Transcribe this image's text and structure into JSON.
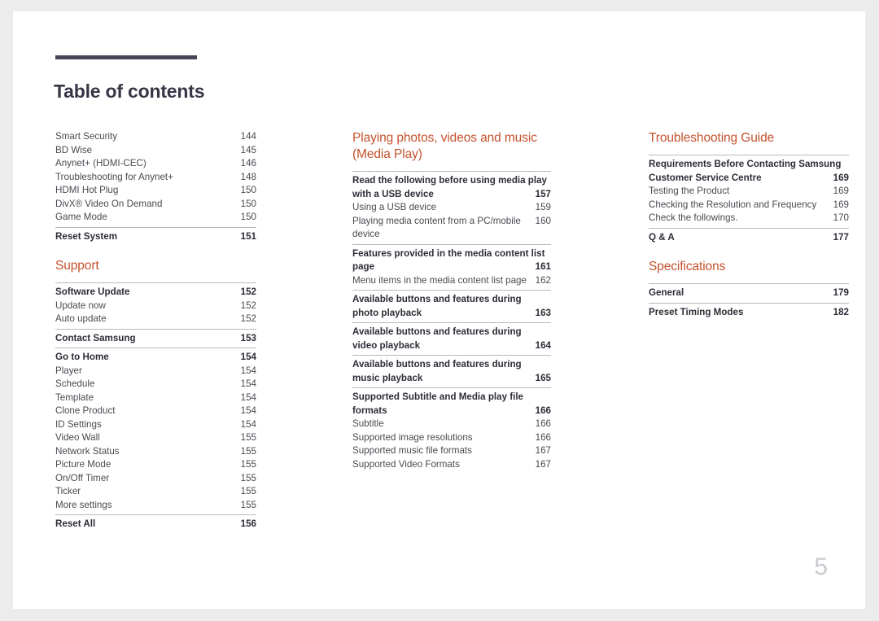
{
  "document": {
    "title": "Table of contents",
    "folio": "5",
    "accent_color": "#c4522c",
    "title_color": "#373646",
    "rule_color": "#474657"
  },
  "columns": [
    {
      "id": "column-1",
      "blocks": [
        {
          "type": "list",
          "heading": null,
          "rows": [
            {
              "label": "Smart Security",
              "num": "144",
              "style": "sub"
            },
            {
              "label": "BD Wise",
              "num": "145",
              "style": "sub"
            },
            {
              "label": "Anynet+ (HDMI-CEC)",
              "num": "146",
              "style": "sub"
            },
            {
              "label": "Troubleshooting for Anynet+",
              "num": "148",
              "style": "sub"
            },
            {
              "label": "HDMI Hot Plug",
              "num": "150",
              "style": "sub"
            },
            {
              "label": "DivX® Video On Demand",
              "num": "150",
              "style": "sub"
            },
            {
              "label": "Game Mode",
              "num": "150",
              "style": "sub"
            },
            {
              "label": "Reset System",
              "num": "151",
              "style": "main"
            }
          ]
        },
        {
          "type": "list",
          "heading": "Support",
          "rows": [
            {
              "label": "Software Update",
              "num": "152",
              "style": "main"
            },
            {
              "label": "Update now",
              "num": "152",
              "style": "sub"
            },
            {
              "label": "Auto update",
              "num": "152",
              "style": "sub"
            },
            {
              "label": "Contact Samsung",
              "num": "153",
              "style": "main"
            },
            {
              "label": "Go to Home",
              "num": "154",
              "style": "main"
            },
            {
              "label": "Player",
              "num": "154",
              "style": "sub"
            },
            {
              "label": "Schedule",
              "num": "154",
              "style": "sub"
            },
            {
              "label": "Template",
              "num": "154",
              "style": "sub"
            },
            {
              "label": "Clone Product",
              "num": "154",
              "style": "sub"
            },
            {
              "label": "ID Settings",
              "num": "154",
              "style": "sub"
            },
            {
              "label": "Video Wall",
              "num": "155",
              "style": "sub"
            },
            {
              "label": "Network Status",
              "num": "155",
              "style": "sub"
            },
            {
              "label": "Picture Mode",
              "num": "155",
              "style": "sub"
            },
            {
              "label": "On/Off Timer",
              "num": "155",
              "style": "sub"
            },
            {
              "label": "Ticker",
              "num": "155",
              "style": "sub"
            },
            {
              "label": "More settings",
              "num": "155",
              "style": "sub"
            },
            {
              "label": "Reset All",
              "num": "156",
              "style": "main"
            }
          ]
        }
      ]
    },
    {
      "id": "column-2",
      "blocks": [
        {
          "type": "list",
          "heading": "Playing photos, videos and music (Media Play)",
          "rows": [
            {
              "label": "Read the following before using media play with a USB device",
              "line1": "Read the following before using media play",
              "line2": "with a USB device",
              "num": "157",
              "style": "main-wrap"
            },
            {
              "label": "Using a USB device",
              "num": "159",
              "style": "sub"
            },
            {
              "label": "Playing media content from a PC/mobile device",
              "num": "160",
              "style": "sub"
            },
            {
              "label": "Features provided in the media content list page",
              "line1": "Features provided in the media content list",
              "line2": "page",
              "num": "161",
              "style": "main-wrap"
            },
            {
              "label": "Menu items in the media content list page",
              "num": "162",
              "style": "sub"
            },
            {
              "label": "Available buttons and features during photo playback",
              "line1": "Available buttons and features during",
              "line2": "photo playback",
              "num": "163",
              "style": "main-wrap"
            },
            {
              "label": "Available buttons and features during video playback",
              "line1": "Available buttons and features during",
              "line2": "video playback",
              "num": "164",
              "style": "main-wrap"
            },
            {
              "label": "Available buttons and features during music playback",
              "line1": "Available buttons and features during",
              "line2": "music playback",
              "num": "165",
              "style": "main-wrap"
            },
            {
              "label": "Supported Subtitle and Media play file formats",
              "line1": "Supported Subtitle and Media play file",
              "line2": "formats",
              "num": "166",
              "style": "main-wrap"
            },
            {
              "label": "Subtitle",
              "num": "166",
              "style": "sub"
            },
            {
              "label": "Supported image resolutions",
              "num": "166",
              "style": "sub"
            },
            {
              "label": "Supported music file formats",
              "num": "167",
              "style": "sub"
            },
            {
              "label": "Supported Video Formats",
              "num": "167",
              "style": "sub"
            }
          ]
        }
      ]
    },
    {
      "id": "column-3",
      "blocks": [
        {
          "type": "list",
          "heading": "Troubleshooting Guide",
          "rows": [
            {
              "label": "Requirements Before Contacting Samsung Customer Service Centre",
              "line1": "Requirements Before Contacting Samsung",
              "line2": "Customer Service Centre",
              "num": "169",
              "style": "main-wrap"
            },
            {
              "label": "Testing the Product",
              "num": "169",
              "style": "sub"
            },
            {
              "label": "Checking the Resolution and Frequency",
              "num": "169",
              "style": "sub"
            },
            {
              "label": "Check the followings.",
              "num": "170",
              "style": "sub"
            },
            {
              "label": "Q & A",
              "num": "177",
              "style": "main"
            }
          ]
        },
        {
          "type": "list",
          "heading": "Specifications",
          "rows": [
            {
              "label": "General",
              "num": "179",
              "style": "main"
            },
            {
              "label": "Preset Timing Modes",
              "num": "182",
              "style": "main"
            }
          ]
        }
      ]
    }
  ]
}
